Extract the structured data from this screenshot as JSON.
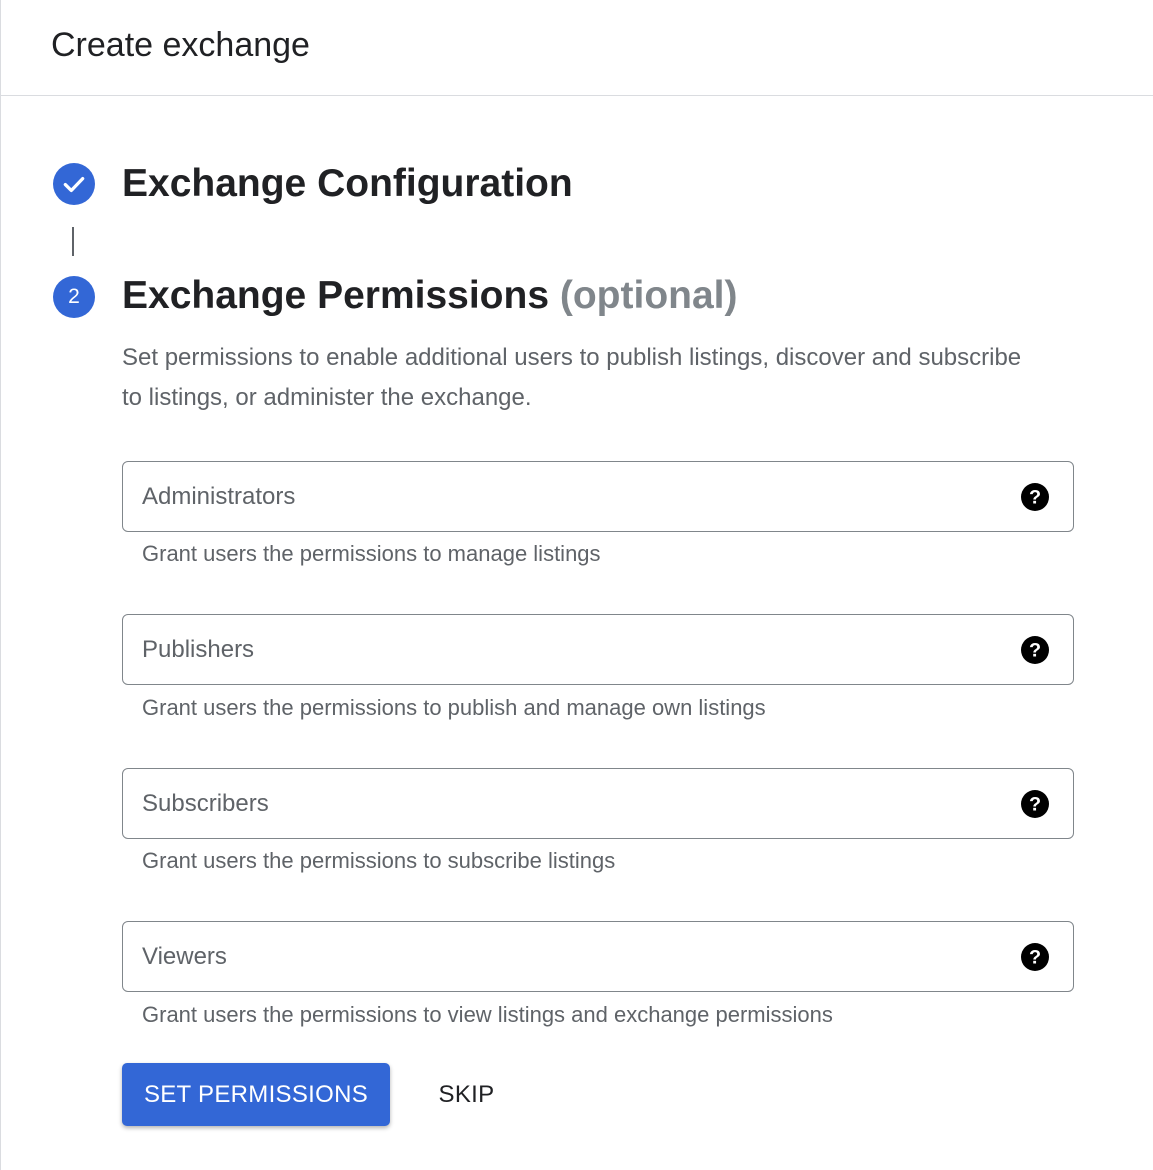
{
  "header": {
    "title": "Create exchange"
  },
  "stepper": {
    "step1": {
      "title": "Exchange Configuration",
      "status_icon": "check-icon"
    },
    "step2": {
      "number": "2",
      "title": "Exchange Permissions",
      "optional_label": "(optional)",
      "description": "Set permissions to enable additional users to publish listings, discover and subscribe to listings, or administer the exchange."
    }
  },
  "fields": [
    {
      "placeholder": "Administrators",
      "hint": "Grant users the permissions to manage listings",
      "icon": "help-icon"
    },
    {
      "placeholder": "Publishers",
      "hint": "Grant users the permissions to publish and manage own listings",
      "icon": "help-icon"
    },
    {
      "placeholder": "Subscribers",
      "hint": "Grant users the permissions to subscribe listings",
      "icon": "help-icon"
    },
    {
      "placeholder": "Viewers",
      "hint": "Grant users the permissions to view listings and exchange permissions",
      "icon": "help-icon"
    }
  ],
  "actions": {
    "primary_label": "SET PERMISSIONS",
    "secondary_label": "SKIP"
  },
  "colors": {
    "accent": "#3367d6",
    "text": "#202124",
    "muted": "#5f6368"
  }
}
